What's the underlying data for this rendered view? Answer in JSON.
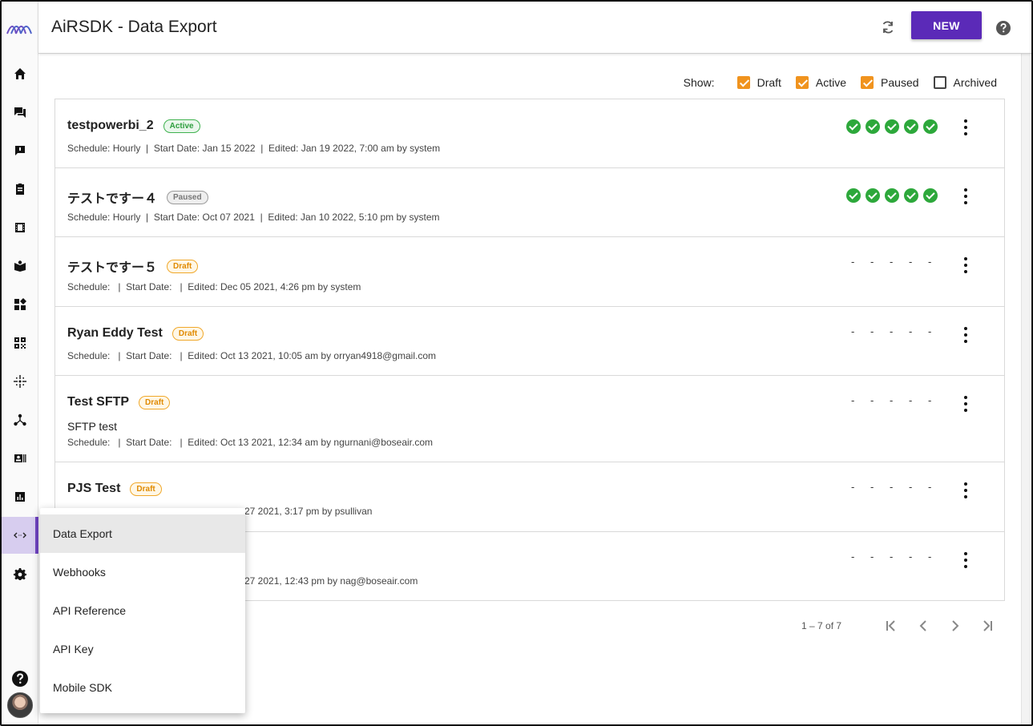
{
  "header": {
    "title": "AiRSDK - Data Export",
    "new_label": "NEW"
  },
  "sidebar": {
    "items": [
      {
        "icon": "home-icon"
      },
      {
        "icon": "chat-icon"
      },
      {
        "icon": "feedback-icon"
      },
      {
        "icon": "clipboard-icon"
      },
      {
        "icon": "film-icon"
      },
      {
        "icon": "book-icon"
      },
      {
        "icon": "widgets-icon"
      },
      {
        "icon": "qr-code-icon"
      },
      {
        "icon": "sparkle-icon"
      },
      {
        "icon": "hub-icon"
      },
      {
        "icon": "contact-card-icon"
      },
      {
        "icon": "analytics-icon"
      },
      {
        "icon": "code-arrows-icon",
        "active": true
      },
      {
        "icon": "gear-icon"
      }
    ],
    "accent": "#6f42c1"
  },
  "filters": {
    "show_label": "Show:",
    "options": [
      {
        "label": "Draft",
        "checked": true
      },
      {
        "label": "Active",
        "checked": true
      },
      {
        "label": "Paused",
        "checked": true
      },
      {
        "label": "Archived",
        "checked": false
      }
    ],
    "check_color": "#f0931e"
  },
  "exports": [
    {
      "title": "testpowerbi_2",
      "status": "Active",
      "status_class": "active",
      "description": "",
      "meta": "Schedule: Hourly  |  Start Date: Jan 15 2022  |  Edited: Jan 19 2022, 7:00 am by system",
      "runs": "success"
    },
    {
      "title": "テストですー４",
      "status": "Paused",
      "status_class": "paused",
      "description": "",
      "meta": "Schedule: Hourly  |  Start Date: Oct 07 2021  |  Edited: Jan 10 2022, 5:10 pm by system",
      "runs": "success"
    },
    {
      "title": "テストですー５",
      "status": "Draft",
      "status_class": "draft",
      "description": "",
      "meta": "Schedule:   |  Start Date:   |  Edited: Dec 05 2021, 4:26 pm by system",
      "runs": "none"
    },
    {
      "title": "Ryan Eddy Test",
      "status": "Draft",
      "status_class": "draft",
      "description": "",
      "meta": "Schedule:   |  Start Date:   |  Edited: Oct 13 2021, 10:05 am by orryan4918@gmail.com",
      "runs": "none"
    },
    {
      "title": "Test SFTP",
      "status": "Draft",
      "status_class": "draft",
      "description": "SFTP test",
      "meta": "Schedule:   |  Start Date:   |  Edited: Oct 13 2021, 12:34 am by ngurnani@boseair.com",
      "runs": "none"
    },
    {
      "title": "PJS Test",
      "status": "Draft",
      "status_class": "draft",
      "description": "",
      "meta": "27 2021, 3:17 pm by psullivan",
      "runs": "none"
    },
    {
      "title": "",
      "status": "",
      "status_class": "",
      "description": "",
      "meta": "27 2021, 12:43 pm by nag@boseair.com",
      "runs": "none"
    }
  ],
  "dash": "-",
  "pager": {
    "range": "1 – 7 of 7"
  },
  "menu": {
    "items": [
      {
        "label": "Data Export",
        "selected": true
      },
      {
        "label": "Webhooks",
        "selected": false
      },
      {
        "label": "API Reference",
        "selected": false
      },
      {
        "label": "API Key",
        "selected": false
      },
      {
        "label": "Mobile SDK",
        "selected": false
      }
    ]
  },
  "colors": {
    "brand_purple": "#5b2ab8",
    "success_green": "#2da83b",
    "draft_orange": "#f0a82a"
  }
}
